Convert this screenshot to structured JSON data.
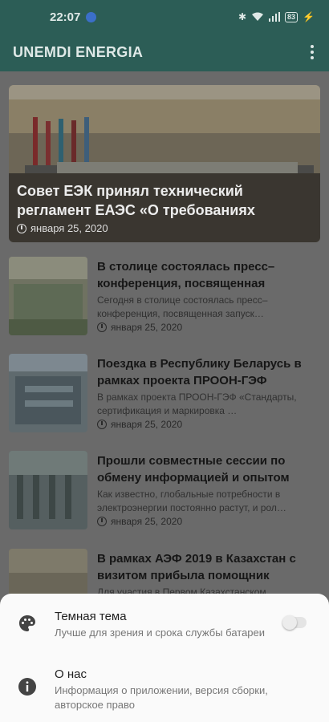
{
  "status_bar": {
    "time": "22:07",
    "battery": "83"
  },
  "app": {
    "title": "UNEMDI ENERGIA"
  },
  "hero": {
    "title": "Совет ЕЭК принял технический регламент ЕАЭС «О требованиях",
    "date": "января 25, 2020"
  },
  "news": [
    {
      "title": "В столице состоялась пресс–конференция, посвященная",
      "desc": "Сегодня в столице состоялась пресс–конференция, посвященная запуск…",
      "date": "января 25, 2020"
    },
    {
      "title": "Поездка в Республику Беларусь в рамках проекта ПРООН-ГЭФ",
      "desc": "В рамках проекта ПРООН-ГЭФ «Стандарты, сертификация и маркировка …",
      "date": "января 25, 2020"
    },
    {
      "title": "Прошли совместные сессии по обмену информацией и опытом",
      "desc": "Как известно, глобальные потребности в электроэнергии постоянно растут, и рол…",
      "date": "января 25, 2020"
    },
    {
      "title": "В рамках АЭФ 2019 в Казахстан с визитом прибыла помощник",
      "desc": "Для участия в Первом Казахстанском",
      "date": ""
    }
  ],
  "menu": {
    "dark_theme": {
      "title": "Темная тема",
      "subtitle": "Лучше для зрения и срока службы батареи",
      "enabled": false
    },
    "about": {
      "title": "О нас",
      "subtitle": "Информация о приложении, версия сборки, авторское право"
    }
  },
  "icons": {
    "location": "location-icon",
    "bluetooth": "bluetooth-icon",
    "wifi": "wifi-icon",
    "clock": "clock-icon",
    "palette": "palette-icon",
    "info": "info-icon",
    "more": "more-vert-icon"
  },
  "colors": {
    "primary": "#2c5d56",
    "sheet": "#fafafa"
  }
}
